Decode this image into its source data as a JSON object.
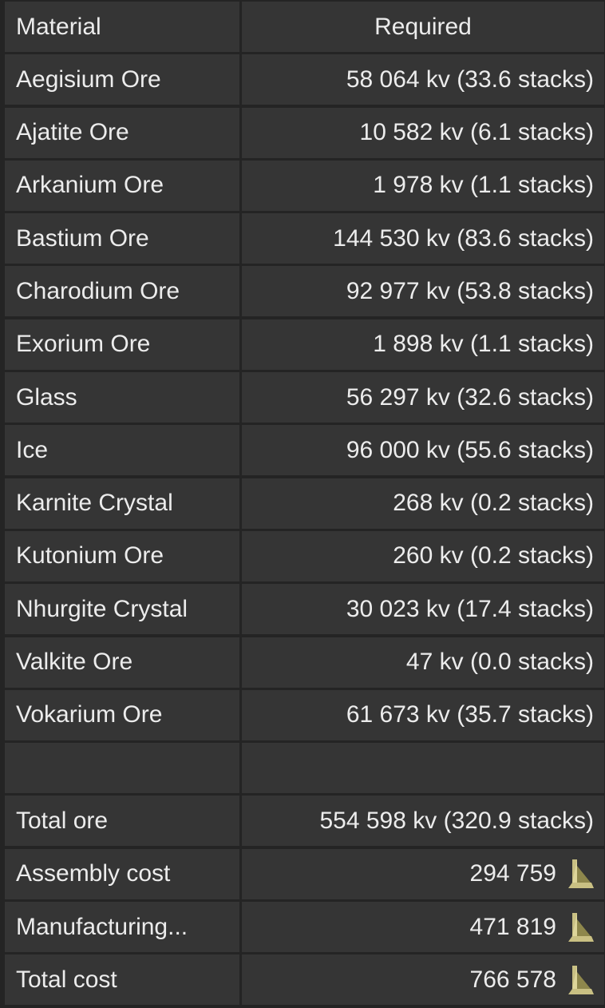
{
  "header": {
    "material_label": "Material",
    "required_label": "Required"
  },
  "materials": [
    {
      "name": "Aegisium Ore",
      "required": "58 064 kv (33.6 stacks)"
    },
    {
      "name": "Ajatite Ore",
      "required": "10 582 kv (6.1 stacks)"
    },
    {
      "name": "Arkanium Ore",
      "required": "1 978 kv (1.1 stacks)"
    },
    {
      "name": "Bastium Ore",
      "required": "144 530 kv (83.6 stacks)"
    },
    {
      "name": "Charodium Ore",
      "required": "92 977 kv (53.8 stacks)"
    },
    {
      "name": "Exorium Ore",
      "required": "1 898 kv (1.1 stacks)"
    },
    {
      "name": "Glass",
      "required": "56 297 kv (32.6 stacks)"
    },
    {
      "name": "Ice",
      "required": "96 000 kv (55.6 stacks)"
    },
    {
      "name": "Karnite Crystal",
      "required": "268 kv (0.2 stacks)"
    },
    {
      "name": "Kutonium Ore",
      "required": "260 kv (0.2 stacks)"
    },
    {
      "name": "Nhurgite Crystal",
      "required": "30 023 kv (17.4 stacks)"
    },
    {
      "name": "Valkite Ore",
      "required": "47 kv (0.0 stacks)"
    },
    {
      "name": "Vokarium Ore",
      "required": "61 673 kv (35.7 stacks)"
    }
  ],
  "summary": {
    "total_ore_label": "Total ore",
    "total_ore_value": "554 598 kv (320.9 stacks)",
    "assembly_cost_label": "Assembly cost",
    "assembly_cost_value": "294 759",
    "manufacturing_label": "Manufacturing...",
    "manufacturing_value": "471 819",
    "total_cost_label": "Total cost",
    "total_cost_value": "766 578"
  },
  "icons": {
    "currency": "currency-icon"
  },
  "colors": {
    "cell_bg": "#353535",
    "page_bg": "#242424",
    "text": "#ececec",
    "currency_gold": "#c9c083"
  }
}
